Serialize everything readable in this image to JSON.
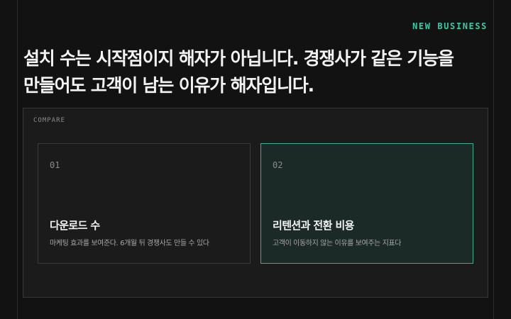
{
  "eyebrow": "NEW BUSINESS",
  "headline": {
    "line1": "설치 수는 시작점이지 해자가 아닙니다. 경쟁사가 같은 기능을",
    "line2": "만들어도 고객이 남는 이유가 해자입니다."
  },
  "compare": {
    "label": "COMPARE",
    "cards": [
      {
        "number": "01",
        "title": "다운로드 수",
        "description": "마케팅 효과를 보여준다. 6개월 뒤 경쟁사도 만들 수 있다",
        "highlighted": false
      },
      {
        "number": "02",
        "title": "리텐션과 전환 비용",
        "description": "고객이 이동하지 않는 이유를 보여주는 지표다",
        "highlighted": true
      }
    ]
  },
  "colors": {
    "background": "#121212",
    "accent": "#3ccaa6",
    "highlight_card_bg": "#1c2a27",
    "highlight_card_border": "#35b091"
  }
}
